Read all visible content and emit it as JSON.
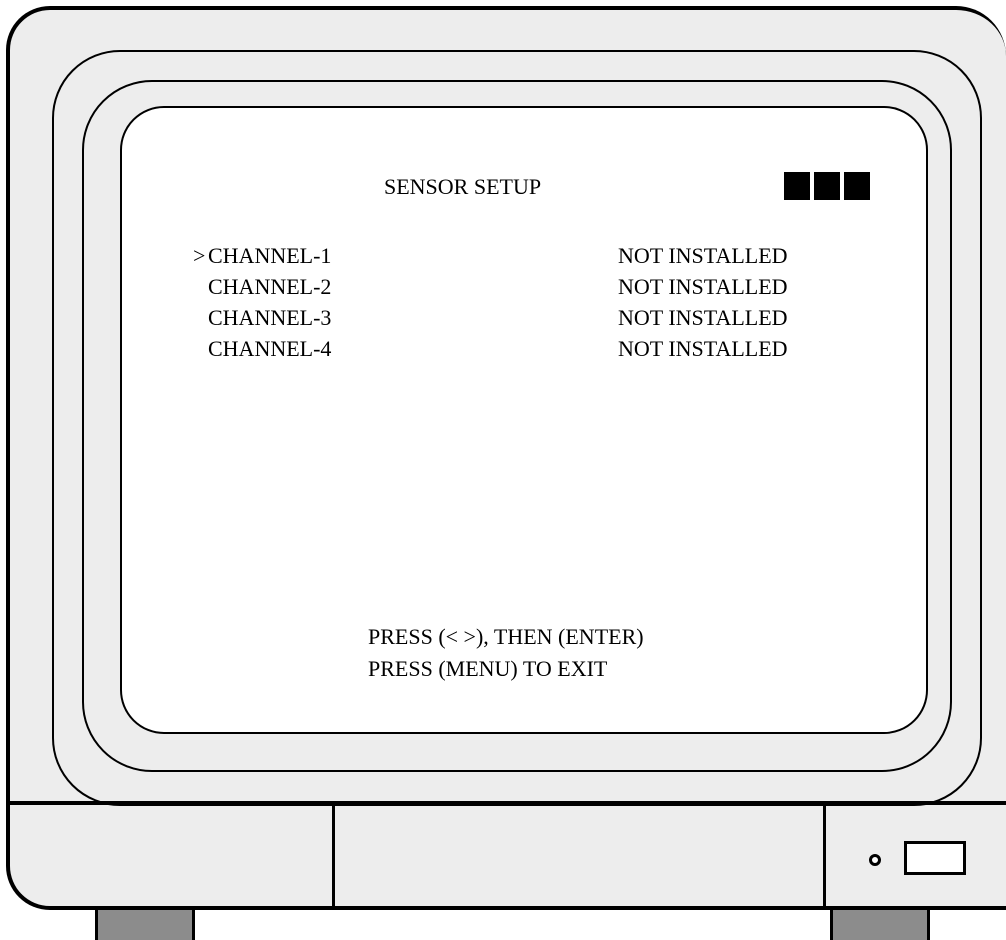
{
  "osd": {
    "title": "SENSOR SETUP",
    "cursor": ">",
    "channels": [
      {
        "label": "CHANNEL-1",
        "status": "NOT INSTALLED",
        "selected": true
      },
      {
        "label": "CHANNEL-2",
        "status": "NOT INSTALLED",
        "selected": false
      },
      {
        "label": "CHANNEL-3",
        "status": "NOT INSTALLED",
        "selected": false
      },
      {
        "label": "CHANNEL-4",
        "status": "NOT INSTALLED",
        "selected": false
      }
    ],
    "instructions": [
      "PRESS (< >), THEN (ENTER)",
      "PRESS (MENU) TO EXIT"
    ],
    "indicator_blocks": 3
  },
  "colors": {
    "screen_background": "#ffffff",
    "monitor_body": "#ededed",
    "stand": "#8c8c8c",
    "text": "#000000"
  },
  "icons": [
    "power-led-icon",
    "power-button-icon"
  ]
}
